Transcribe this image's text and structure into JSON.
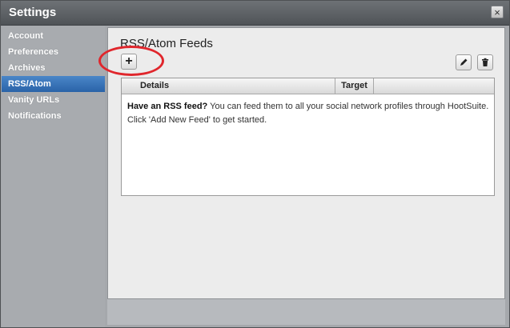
{
  "window": {
    "title": "Settings",
    "close_label": "×"
  },
  "sidebar": {
    "items": [
      {
        "label": "Account"
      },
      {
        "label": "Preferences"
      },
      {
        "label": "Archives"
      },
      {
        "label": "RSS/Atom",
        "active": true
      },
      {
        "label": "Vanity URLs"
      },
      {
        "label": "Notifications"
      }
    ]
  },
  "panel": {
    "title": "RSS/Atom Feeds",
    "toolbar": {
      "add_label": "+",
      "edit_icon": "pencil-icon",
      "delete_icon": "trash-icon"
    },
    "table": {
      "columns": [
        "Details",
        "Target"
      ],
      "empty_lead": "Have an RSS feed?",
      "empty_line1": " You can feed them to all your social network profiles through HootSuite.",
      "empty_line2": "Click 'Add New Feed' to get started."
    }
  },
  "colors": {
    "active_item": "#2a63a8",
    "highlight": "#e0262c"
  }
}
